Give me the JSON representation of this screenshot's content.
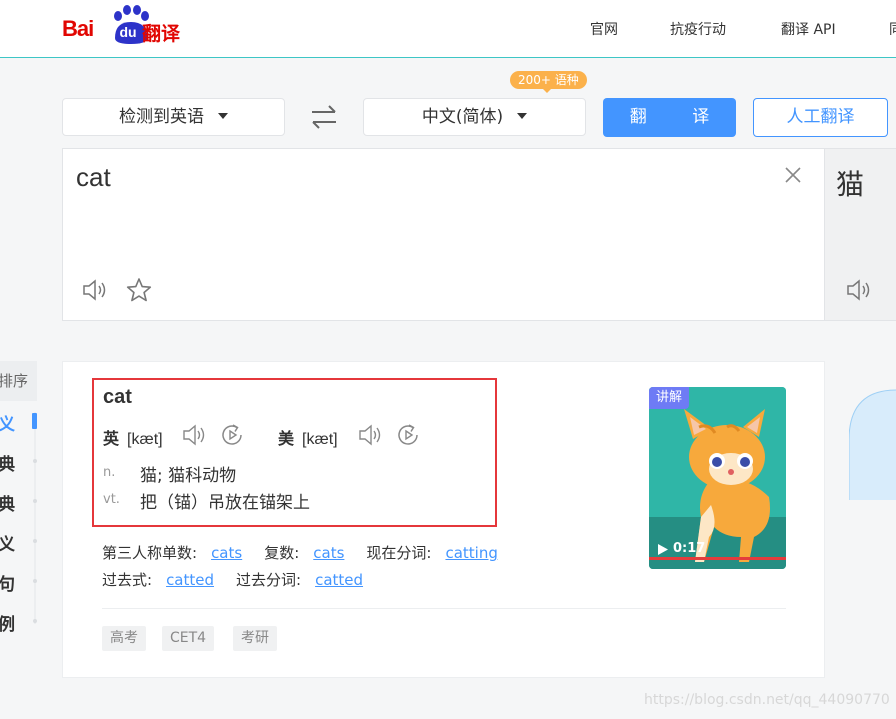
{
  "logo": {
    "brand": "Bai",
    "du": "du",
    "suffix": "翻译"
  },
  "nav": {
    "items": [
      "官网",
      "抗疫行动",
      "翻译 API",
      "同"
    ]
  },
  "lang_bar": {
    "source_lang": "检测到英语",
    "target_lang": "中文(简体)",
    "badge": "200+ 语种",
    "translate_button": "翻 译",
    "human_button": "人工翻译"
  },
  "input": {
    "text": "cat"
  },
  "output": {
    "text": "猫"
  },
  "side": {
    "sort": "排序",
    "items": [
      "义",
      "典",
      "典",
      "义",
      "句",
      "例"
    ]
  },
  "dict": {
    "word": "cat",
    "uk_label": "英",
    "uk_ipa": "[kæt]",
    "us_label": "美",
    "us_ipa": "[kæt]",
    "meanings": [
      {
        "pos": "n.",
        "text": "猫;  猫科动物"
      },
      {
        "pos": "vt.",
        "text": "把（锚）吊放在锚架上"
      }
    ],
    "forms_row1": [
      {
        "label": "第三人称单数:",
        "value": "cats"
      },
      {
        "label": "复数:",
        "value": "cats"
      },
      {
        "label": "现在分词:",
        "value": "catting"
      }
    ],
    "forms_row2": [
      {
        "label": "过去式:",
        "value": "catted"
      },
      {
        "label": "过去分词:",
        "value": "catted"
      }
    ],
    "tags": [
      "高考",
      "CET4",
      "考研"
    ],
    "video": {
      "tag": "讲解",
      "duration": "0:17"
    }
  },
  "watermark": "https://blog.csdn.net/qq_44090770",
  "colors": {
    "brand_red": "#e10602",
    "accent_blue": "#4395ff",
    "badge_orange": "#fbb14b",
    "highlight_red": "#e5373b"
  }
}
